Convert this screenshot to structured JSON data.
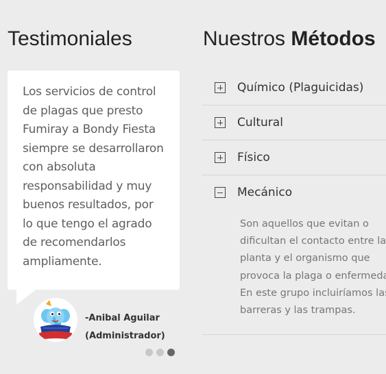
{
  "testimonials": {
    "title": "Testimoniales",
    "quote": "Los servicios de control de plagas que presto Fumiray a Bondy Fiesta siempre se desarrollaron con absoluta responsabilidad y muy buenos resultados, por lo que tengo el agrado de recomendarlos ampliamente.",
    "author_name": "-Anibal Aguilar",
    "author_role": "(Administrador)",
    "avatar_logo_text": "Bondy Fiesta",
    "slides_total": 3,
    "active_slide": 3
  },
  "methods": {
    "title_regular": "Nuestros",
    "title_bold": "Métodos",
    "items": [
      {
        "label": "Químico (Plaguicidas)",
        "expanded": false,
        "icon": "plus-icon"
      },
      {
        "label": "Cultural",
        "expanded": false,
        "icon": "plus-icon"
      },
      {
        "label": "Físico",
        "expanded": false,
        "icon": "plus-icon"
      },
      {
        "label": "Mecánico",
        "expanded": true,
        "icon": "minus-icon",
        "body_lines": [
          "Son aquellos que evitan o",
          "dificultan el contacto entre la",
          "planta y el organismo que",
          "provoca la plaga o enfermedad.",
          "En este grupo incluiríamos las",
          "barreras y las trampas."
        ]
      }
    ]
  },
  "colors": {
    "page_background": "#ececec",
    "card_background": "#ffffff",
    "active_dot": "#666666",
    "inactive_dot": "#c7c7c7"
  }
}
